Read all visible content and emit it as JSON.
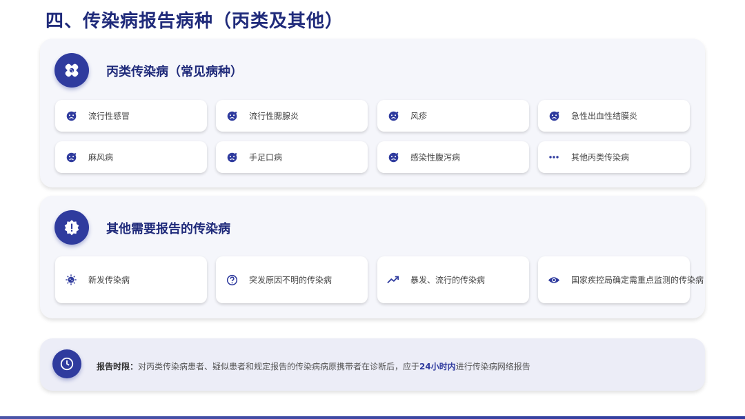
{
  "title": "四、传染病报告病种（丙类及其他）",
  "colors": {
    "primary": "#2f3b9e",
    "title": "#1f2a7a",
    "card_bg": "#f5f6fb"
  },
  "section_a": {
    "title": "丙类传染病（常见病种）",
    "icon": "bandage-icon",
    "items": [
      {
        "label": "流行性感冒",
        "icon": "virus-face-icon"
      },
      {
        "label": "流行性腮腺炎",
        "icon": "virus-face-icon"
      },
      {
        "label": "风疹",
        "icon": "virus-face-icon"
      },
      {
        "label": "急性出血性结膜炎",
        "icon": "virus-face-icon"
      },
      {
        "label": "麻风病",
        "icon": "virus-face-icon"
      },
      {
        "label": "手足口病",
        "icon": "virus-face-icon"
      },
      {
        "label": "感染性腹泻病",
        "icon": "virus-face-icon"
      },
      {
        "label": "其他丙类传染病",
        "icon": "more-dots-icon"
      }
    ]
  },
  "section_b": {
    "title": "其他需要报告的传染病",
    "icon": "alert-icon",
    "items": [
      {
        "label": "新发传染病",
        "icon": "virus-icon"
      },
      {
        "label": "突发原因不明的传染病",
        "icon": "question-icon"
      },
      {
        "label": "暴发、流行的传染病",
        "icon": "trending-up-icon"
      },
      {
        "label": "国家疾控局确定需重点监测的传染病",
        "icon": "eye-icon"
      }
    ]
  },
  "note": {
    "icon": "clock-icon",
    "label": "报告时限：",
    "text_before": "对丙类传染病患者、疑似患者和规定报告的传染病病原携带者在诊断后，应于",
    "highlight": "24小时内",
    "text_after": "进行传染病网络报告"
  }
}
